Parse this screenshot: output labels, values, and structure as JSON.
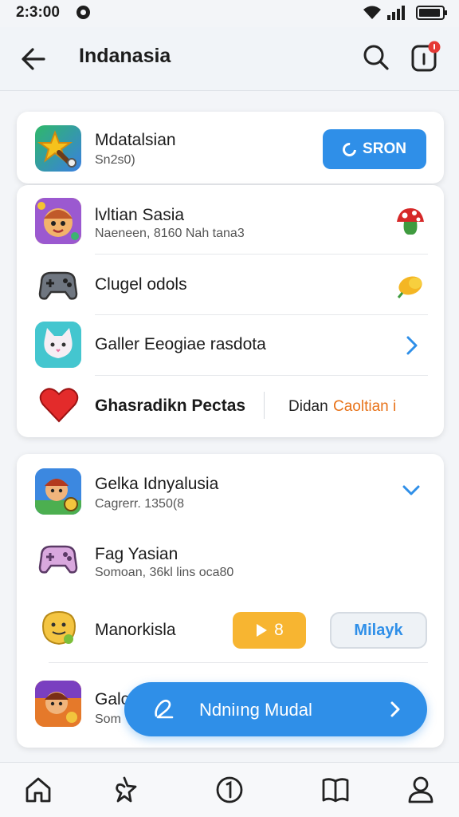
{
  "status_bar": {
    "time": "2:3:00"
  },
  "app_bar": {
    "title": "Indanasia"
  },
  "card1": {
    "header": {
      "title": "Mdatalsian",
      "subtitle": "Sn2s0)",
      "button_label": "SRON"
    },
    "rows": [
      {
        "title": "lvltian Sasia",
        "subtitle": "Naeneen, 8160 Nah tana3"
      },
      {
        "title": "Clugel odols"
      },
      {
        "title": "Galler Eeogiae rasdota"
      },
      {
        "title": "Ghasradikn Pectas",
        "extra_prefix": "Didan",
        "extra_highlight": "Caoltian i"
      }
    ]
  },
  "card2": {
    "rows": [
      {
        "title": "Gelka Idnyalusia",
        "subtitle": "Cagrerr. 1350(8"
      },
      {
        "title": "Fag Yasian",
        "subtitle": "Somoan, 36kl lins oca80"
      },
      {
        "title": "Manorkisla",
        "orange_button_label": "8",
        "gray_button_label": "Milayk"
      },
      {
        "title": "Galc",
        "subtitle": "Som"
      }
    ]
  },
  "fab": {
    "label": "Ndniıng  Mudal"
  },
  "colors": {
    "accent": "#2f8fe8",
    "orange": "#f7b531",
    "notification": "#e53935",
    "highlight_text": "#e8731a"
  },
  "icons": [
    "back-arrow-icon",
    "search-icon",
    "notification-icon",
    "star-wand-icon",
    "cartoon-face-icon",
    "mushroom-icon",
    "gamepad-icon",
    "lemon-icon",
    "cat-icon",
    "chevron-right-icon",
    "heart-icon",
    "avatar-icon",
    "chevron-down-icon",
    "pink-gamepad-icon",
    "yellow-blob-icon",
    "play-icon",
    "edit-icon",
    "home-icon",
    "explore-icon",
    "info-icon",
    "bookmark-icon",
    "profile-icon"
  ]
}
